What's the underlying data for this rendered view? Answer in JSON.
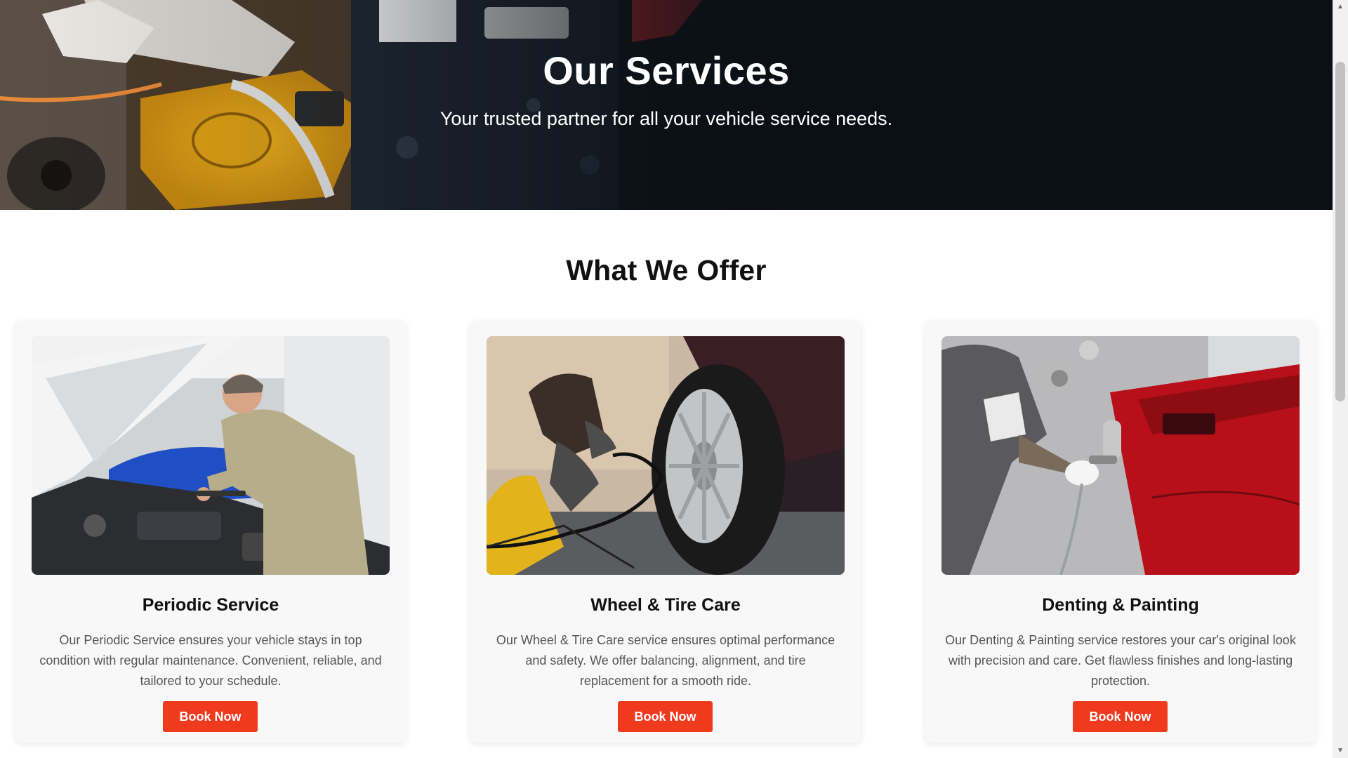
{
  "hero": {
    "title": "Our Services",
    "subtitle": "Your trusted partner for all your vehicle service needs."
  },
  "offer": {
    "heading": "What We Offer",
    "cards": [
      {
        "title": "Periodic Service",
        "description": "Our Periodic Service ensures your vehicle stays in top condition with regular maintenance. Convenient, reliable, and tailored to your schedule.",
        "button": "Book Now"
      },
      {
        "title": "Wheel & Tire Care",
        "description": "Our Wheel & Tire Care service ensures optimal performance and safety. We offer balancing, alignment, and tire replacement for a smooth ride.",
        "button": "Book Now"
      },
      {
        "title": "Denting & Painting",
        "description": "Our Denting & Painting service restores your car's original look with precision and care. Get flawless finishes and long-lasting protection.",
        "button": "Book Now"
      }
    ]
  },
  "colors": {
    "accent": "#f03a1e",
    "hero_bg": "#0b1016",
    "card_bg": "#f8f8f8"
  },
  "icons": {
    "scroll_up": "chevron-up-icon",
    "scroll_down": "chevron-down-icon"
  }
}
